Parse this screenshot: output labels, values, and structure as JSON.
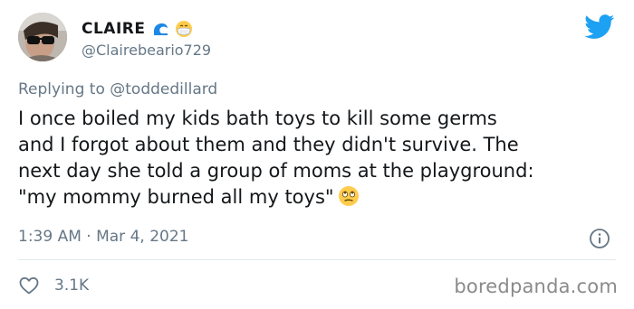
{
  "user": {
    "display_name": "CLAIRE",
    "name_emojis": [
      "wave-emoji",
      "medical-mask-emoji"
    ],
    "handle": "@Clairebeario729",
    "avatar": "avatar-photo"
  },
  "reply": {
    "prefix": "Replying to",
    "mention": "@toddedillard"
  },
  "tweet": {
    "lines": [
      "I once boiled my kids bath toys to kill some germs",
      "and I forgot about them and they didn't survive. The",
      "next day she told a group of moms at the playground:",
      "\"my mommy burned all my toys\""
    ],
    "trailing_emoji": "face-with-rolling-eyes-emoji"
  },
  "meta": {
    "timestamp": "1:39 AM · Mar 4, 2021",
    "info_icon": "info-icon"
  },
  "engagement": {
    "likes": "3.1K",
    "like_icon": "heart-icon"
  },
  "watermark": "boredpanda.com",
  "colors": {
    "text": "#14171a",
    "secondary": "#657786",
    "twitter_blue": "#1da1f2",
    "divider": "#e1e8ed",
    "watermark": "#8a8a8a"
  }
}
